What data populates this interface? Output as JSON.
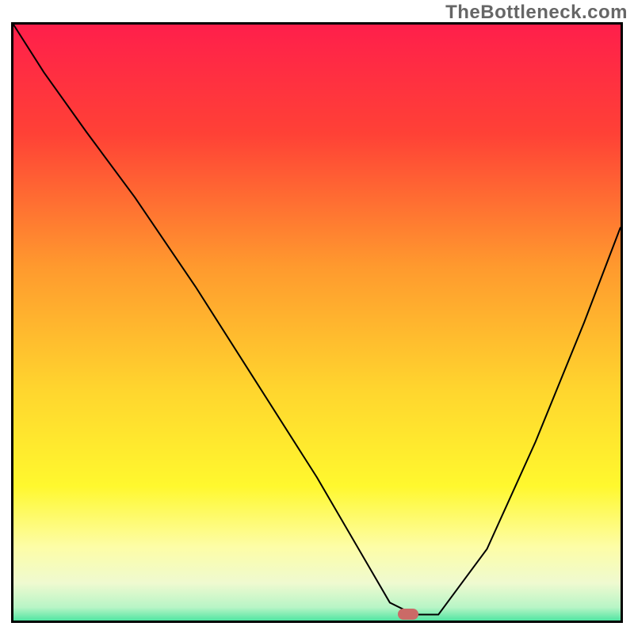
{
  "watermark": "TheBottleneck.com",
  "marker": {
    "color": "#CB6A67",
    "x_pct": 65,
    "y_pct": 99
  },
  "gradient_stops": [
    {
      "offset": 0,
      "color": "#FF1F4B"
    },
    {
      "offset": 18,
      "color": "#FF4136"
    },
    {
      "offset": 40,
      "color": "#FF9A2E"
    },
    {
      "offset": 60,
      "color": "#FFD52E"
    },
    {
      "offset": 76,
      "color": "#FFF82E"
    },
    {
      "offset": 86,
      "color": "#FDFDA6"
    },
    {
      "offset": 92,
      "color": "#EFFAD0"
    },
    {
      "offset": 96,
      "color": "#B8F5C6"
    },
    {
      "offset": 99,
      "color": "#2ADE94"
    },
    {
      "offset": 100,
      "color": "#18C97F"
    }
  ],
  "chart_data": {
    "type": "line",
    "title": "",
    "xlabel": "",
    "ylabel": "",
    "xlim": [
      0,
      100
    ],
    "ylim": [
      0,
      100
    ],
    "series": [
      {
        "name": "bottleneck-curve",
        "x": [
          0,
          5,
          12,
          20,
          30,
          40,
          50,
          58,
          62,
          66,
          70,
          78,
          86,
          94,
          100
        ],
        "y": [
          100,
          92,
          82,
          71,
          56,
          40,
          24,
          10,
          3,
          1,
          1,
          12,
          30,
          50,
          66
        ]
      }
    ],
    "annotations": [
      {
        "name": "optimal-point",
        "x": 65,
        "y": 1
      }
    ]
  }
}
